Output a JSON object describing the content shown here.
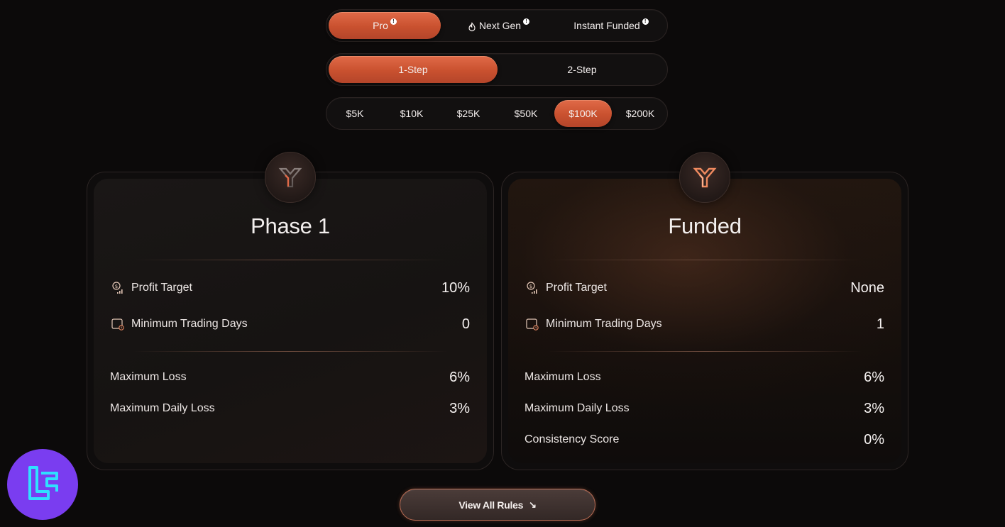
{
  "program_tabs": [
    {
      "label": "Pro",
      "active": true,
      "info": true,
      "icon": null
    },
    {
      "label": "Next Gen",
      "active": false,
      "info": true,
      "icon": "flame-icon"
    },
    {
      "label": "Instant Funded",
      "active": false,
      "info": true,
      "icon": null
    }
  ],
  "step_tabs": [
    {
      "label": "1-Step",
      "active": true
    },
    {
      "label": "2-Step",
      "active": false
    }
  ],
  "size_tabs": [
    {
      "label": "$5K",
      "active": false
    },
    {
      "label": "$10K",
      "active": false
    },
    {
      "label": "$25K",
      "active": false
    },
    {
      "label": "$50K",
      "active": false
    },
    {
      "label": "$100K",
      "active": true
    },
    {
      "label": "$200K",
      "active": false
    }
  ],
  "phase1": {
    "title": "Phase 1",
    "profit_target": {
      "label": "Profit Target",
      "value": "10%",
      "icon": "profit-target-icon"
    },
    "min_days": {
      "label": "Minimum Trading Days",
      "value": "0",
      "icon": "calendar-clock-icon"
    },
    "max_loss": {
      "label": "Maximum Loss",
      "value": "6%"
    },
    "max_daily_loss": {
      "label": "Maximum Daily Loss",
      "value": "3%"
    }
  },
  "funded": {
    "title": "Funded",
    "profit_target": {
      "label": "Profit Target",
      "value": "None",
      "icon": "profit-target-icon"
    },
    "min_days": {
      "label": "Minimum Trading Days",
      "value": "1",
      "icon": "calendar-clock-icon"
    },
    "max_loss": {
      "label": "Maximum Loss",
      "value": "6%"
    },
    "max_daily_loss": {
      "label": "Maximum Daily Loss",
      "value": "3%"
    },
    "consistency": {
      "label": "Consistency Score",
      "value": "0%"
    }
  },
  "view_all": {
    "label": "View All Rules",
    "arrow": "↘"
  },
  "colors": {
    "accent": "#d9603f",
    "background": "#0c0a0a",
    "corner_logo": "#7a3df0",
    "corner_logo_mark": "#2fe0ff"
  }
}
